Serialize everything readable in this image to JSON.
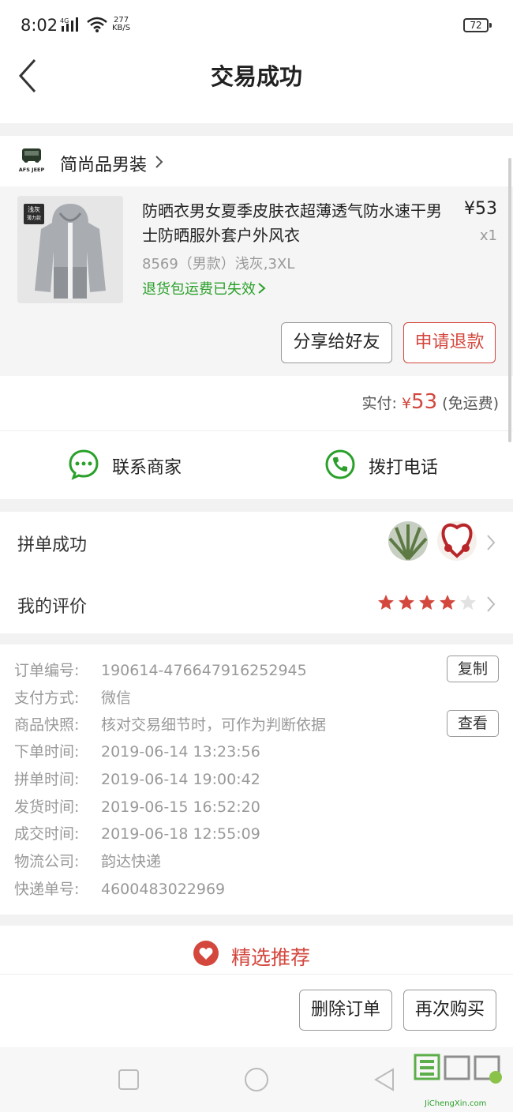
{
  "status_bar": {
    "time": "8:02",
    "network": "4G",
    "speed_value": "277",
    "speed_unit": "KB/S",
    "battery": "72"
  },
  "header": {
    "title": "交易成功",
    "back_icon": "chevron-left-icon"
  },
  "shop": {
    "logo_text": "AFS JEEP",
    "name": "简尚品男装"
  },
  "product": {
    "tag_line1": "浅灰",
    "tag_line2": "薄力款",
    "title": "防晒衣男女夏季皮肤衣超薄透气防水速干男士防晒服外套户外风衣",
    "price": "¥53",
    "quantity": "x1",
    "sku": "8569（男款）浅灰,3XL",
    "return_notice": "退货包运费已失效",
    "share_button": "分享给好友",
    "refund_button": "申请退款"
  },
  "payment": {
    "label": "实付:",
    "currency": "¥",
    "amount": "53",
    "note": "(免运费)"
  },
  "contact": {
    "merchant_label": "联系商家",
    "phone_label": "拨打电话"
  },
  "group_buy": {
    "label": "拼单成功"
  },
  "review": {
    "label": "我的评价",
    "rating": 4,
    "max_rating": 5
  },
  "order_info": {
    "rows": [
      {
        "label": "订单编号:",
        "value": "190614-476647916252945"
      },
      {
        "label": "支付方式:",
        "value": "微信"
      },
      {
        "label": "商品快照:",
        "value": "核对交易细节时，可作为判断依据"
      },
      {
        "label": "下单时间:",
        "value": "2019-06-14 13:23:56"
      },
      {
        "label": "拼单时间:",
        "value": "2019-06-14 19:00:42"
      },
      {
        "label": "发货时间:",
        "value": "2019-06-15 16:52:20"
      },
      {
        "label": "成交时间:",
        "value": "2019-06-18 12:55:09"
      },
      {
        "label": "物流公司:",
        "value": "韵达快递"
      },
      {
        "label": "快递单号:",
        "value": "4600483022969"
      }
    ],
    "copy_button": "复制",
    "view_button": "查看"
  },
  "recommend": {
    "label": "精选推荐"
  },
  "bottom_actions": {
    "delete_button": "删除订单",
    "rebuy_button": "再次购买"
  },
  "watermark": {
    "text": "JiChengXin.com"
  },
  "colors": {
    "accent_red": "#d3473d",
    "green": "#2aa02a"
  }
}
